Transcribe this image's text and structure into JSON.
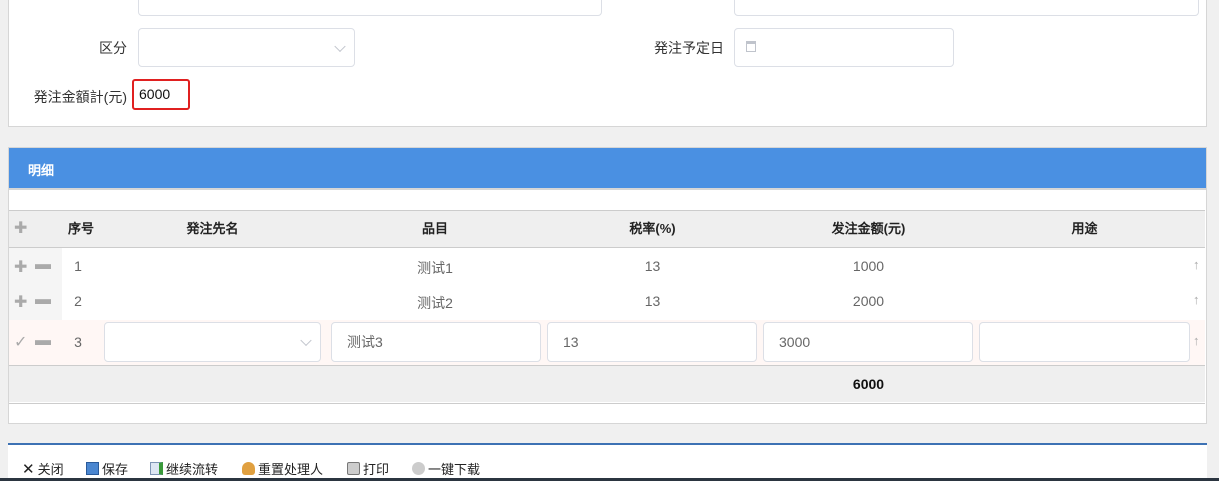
{
  "form": {
    "kubun_label": "区分",
    "kubun_value": "",
    "order_date_label": "発注予定日",
    "order_total_label": "発注金額計(元)",
    "order_total_value": "6000"
  },
  "detail": {
    "title": "明细",
    "columns": [
      "序号",
      "発注先名",
      "品目",
      "税率(%)",
      "发注金额(元)",
      "用途"
    ],
    "rows": [
      {
        "no": "1",
        "supplier": "",
        "item": "测试1",
        "tax": "13",
        "amount": "1000",
        "usage": ""
      },
      {
        "no": "2",
        "supplier": "",
        "item": "测试2",
        "tax": "13",
        "amount": "2000",
        "usage": ""
      },
      {
        "no": "3",
        "supplier": "",
        "item": "测试3",
        "tax": "13",
        "amount": "3000",
        "usage": ""
      }
    ],
    "total_amount": "6000"
  },
  "toolbar": {
    "close": "关闭",
    "save": "保存",
    "continue": "继续流转",
    "reset_handler": "重置处理人",
    "print": "打印",
    "download": "一键下载"
  },
  "colors": {
    "header_blue": "#4a90e2",
    "highlight_red": "#e02020"
  }
}
